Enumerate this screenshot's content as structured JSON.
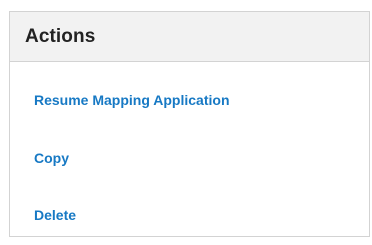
{
  "panel": {
    "title": "Actions",
    "actions": [
      {
        "label": "Resume Mapping Application"
      },
      {
        "label": "Copy"
      },
      {
        "label": "Delete"
      }
    ]
  },
  "colors": {
    "link": "#1779c4",
    "header_bg": "#f2f2f2",
    "border": "#d3d3d3"
  }
}
